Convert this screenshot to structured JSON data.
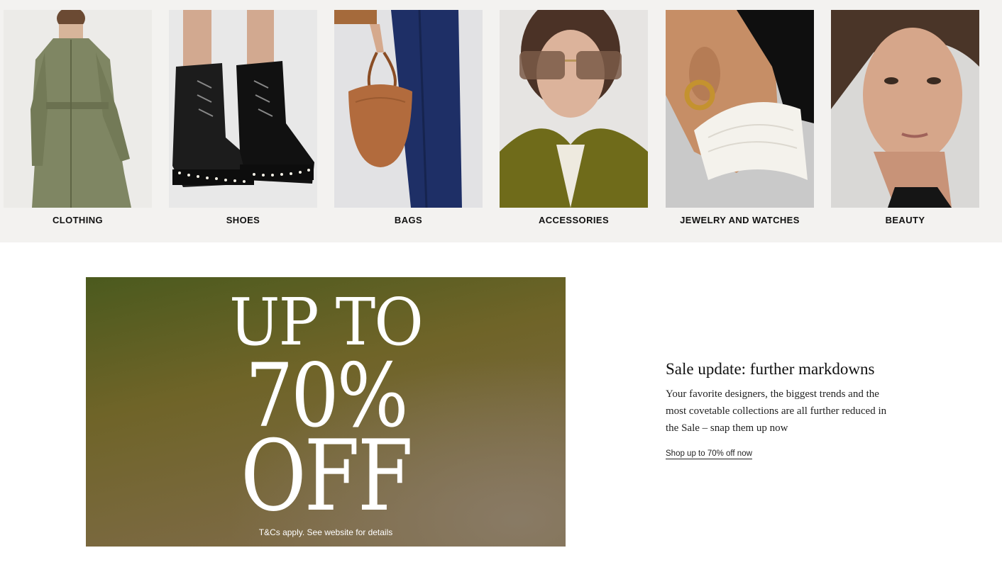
{
  "categories": [
    {
      "label": "CLOTHING",
      "image": "trench-coat-model-photo"
    },
    {
      "label": "SHOES",
      "image": "black-lace-up-boots-photo"
    },
    {
      "label": "BAGS",
      "image": "brown-croc-handbag-photo"
    },
    {
      "label": "ACCESSORIES",
      "image": "sunglasses-model-photo"
    },
    {
      "label": "JEWELRY AND WATCHES",
      "image": "gold-hoop-earring-photo"
    },
    {
      "label": "BEAUTY",
      "image": "beauty-portrait-photo"
    }
  ],
  "promo": {
    "line1": "UP TO",
    "line2": "70%",
    "line3": "OFF",
    "fine_print": "T&Cs apply. See website for details",
    "colors": {
      "top": "#4b5a1e",
      "bottom": "#806c4a",
      "text": "#ffffff"
    }
  },
  "sale": {
    "title": "Sale update: further markdowns",
    "body": "Your favorite designers, the biggest trends and the most covetable collections are all further reduced in the Sale – snap them up now",
    "link": "Shop up to 70% off now"
  },
  "colors": {
    "band_background": "#f3f2f0",
    "text": "#111111"
  }
}
